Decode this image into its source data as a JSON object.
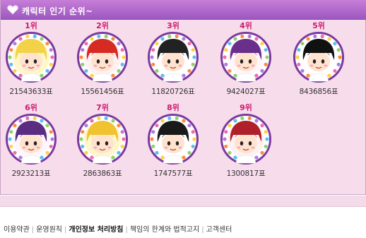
{
  "header": {
    "title": "캐릭터 인기 순위~",
    "icon": "heart-icon"
  },
  "characters": [
    {
      "rank": "1위",
      "votes": "21543633표",
      "hair": "#f3d24a",
      "bg": "#fff6c9"
    },
    {
      "rank": "2위",
      "votes": "15561456표",
      "hair": "#d62a22",
      "bg": "#fff1f1"
    },
    {
      "rank": "3위",
      "votes": "11820726표",
      "hair": "#222222",
      "bg": "#ffffff"
    },
    {
      "rank": "4위",
      "votes": "9424027표",
      "hair": "#6a2f8a",
      "bg": "#fff6fb"
    },
    {
      "rank": "5위",
      "votes": "8436856표",
      "hair": "#111111",
      "bg": "#ffffff"
    },
    {
      "rank": "6위",
      "votes": "2923213표",
      "hair": "#5a2d83",
      "bg": "#fff6fb"
    },
    {
      "rank": "7위",
      "votes": "2863863표",
      "hair": "#f2c331",
      "bg": "#fff6c9"
    },
    {
      "rank": "8위",
      "votes": "1747577표",
      "hair": "#1a1a1a",
      "bg": "#ffffff"
    },
    {
      "rank": "9위",
      "votes": "1300817표",
      "hair": "#b0202a",
      "bg": "#fff1f1"
    }
  ],
  "footer": {
    "links": [
      {
        "label": "이용약관",
        "bold": false
      },
      {
        "label": "운영원칙",
        "bold": false
      },
      {
        "label": "개인정보 처리방침",
        "bold": true
      },
      {
        "label": "책임의 한계와 법적고지",
        "bold": false
      },
      {
        "label": "고객센터",
        "bold": false
      }
    ],
    "separator": "|"
  },
  "colors": {
    "header": "#a865c8",
    "panel": "#f7dcec",
    "rank": "#cc1a6e",
    "ring": "#7a3aa0"
  }
}
